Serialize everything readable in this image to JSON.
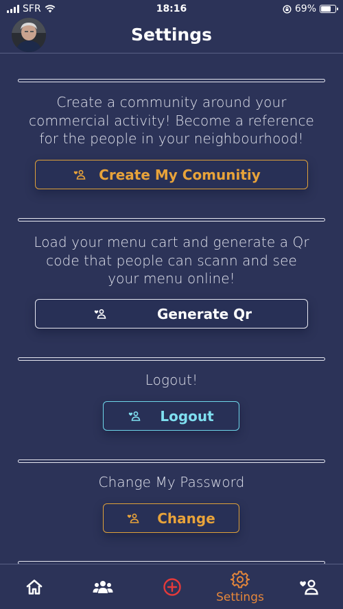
{
  "status_bar": {
    "carrier": "SFR",
    "time": "18:16",
    "battery_percent": "69%",
    "battery_level": 0.69
  },
  "header": {
    "title": "Settings"
  },
  "sections": {
    "community": {
      "text_lines": [
        "Create a community around your",
        "commercial activity! Become a reference",
        "for the people in your neighbourhood!"
      ],
      "button_label": "Create My Comunitiy"
    },
    "qr": {
      "text_lines": [
        "Load your menu cart and generate a Qr",
        "code that people can scann and see",
        "your menu online!"
      ],
      "button_label": "Generate Qr"
    },
    "logout": {
      "text": "Logout!",
      "button_label": "Logout"
    },
    "password": {
      "text": "Change My Password",
      "button_label": "Change"
    }
  },
  "bottom_nav": {
    "items": [
      {
        "icon": "home-icon"
      },
      {
        "icon": "users-icon"
      },
      {
        "icon": "plus-circle-icon"
      },
      {
        "icon": "gear-icon",
        "label": "Settings"
      },
      {
        "icon": "user-heart-icon"
      }
    ]
  },
  "colors": {
    "background": "#2c3358",
    "gold": "#e8a33a",
    "cyan": "#7fdff0",
    "red": "#e53a3a",
    "orange": "#e6873a"
  }
}
